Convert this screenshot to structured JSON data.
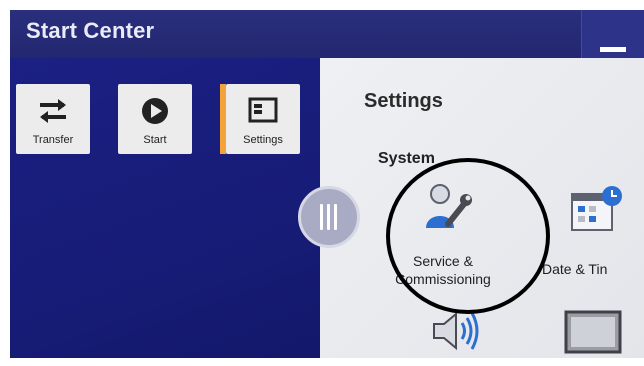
{
  "window": {
    "title": "Start Center"
  },
  "toolbar": {
    "tiles": [
      {
        "label": "Transfer",
        "icon": "transfer-icon"
      },
      {
        "label": "Start",
        "icon": "start-icon"
      },
      {
        "label": "Settings",
        "icon": "settings-icon",
        "selected": true
      }
    ]
  },
  "settings": {
    "title": "Settings",
    "section": "System",
    "apps": [
      {
        "label_line1": "Service &",
        "label_line2": "Commissioning",
        "icon": "service-commissioning-icon"
      },
      {
        "label_line1": "Date & Tin",
        "icon": "calendar-clock-icon"
      },
      {
        "icon": "speaker-icon"
      },
      {
        "icon": "display-icon"
      }
    ]
  },
  "colors": {
    "titlebar": "#23276f",
    "panel": "#171c77",
    "accent": "#f4a23a",
    "icon_blue": "#2c6fd1"
  }
}
